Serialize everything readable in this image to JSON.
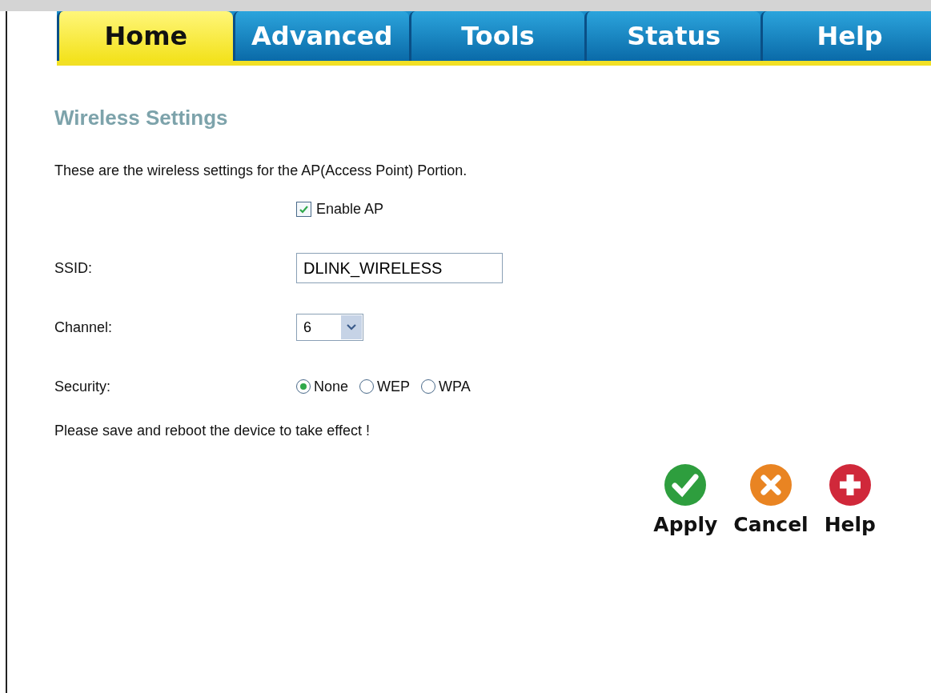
{
  "tabs": [
    {
      "label": "Home",
      "selected": true
    },
    {
      "label": "Advanced",
      "selected": false
    },
    {
      "label": "Tools",
      "selected": false
    },
    {
      "label": "Status",
      "selected": false
    },
    {
      "label": "Help",
      "selected": false
    }
  ],
  "title": "Wireless Settings",
  "description": "These are the wireless settings for the AP(Access Point) Portion.",
  "enable_ap": {
    "label": "Enable AP",
    "checked": true
  },
  "ssid": {
    "label": "SSID:",
    "value": "DLINK_WIRELESS"
  },
  "channel": {
    "label": "Channel:",
    "value": "6"
  },
  "security": {
    "label": "Security:",
    "options": [
      {
        "label": "None",
        "selected": true
      },
      {
        "label": "WEP",
        "selected": false
      },
      {
        "label": "WPA",
        "selected": false
      }
    ]
  },
  "note": "Please save and reboot the device to take effect !",
  "actions": [
    {
      "kind": "apply",
      "label": "Apply"
    },
    {
      "kind": "cancel",
      "label": "Cancel"
    },
    {
      "kind": "help",
      "label": "Help"
    }
  ]
}
